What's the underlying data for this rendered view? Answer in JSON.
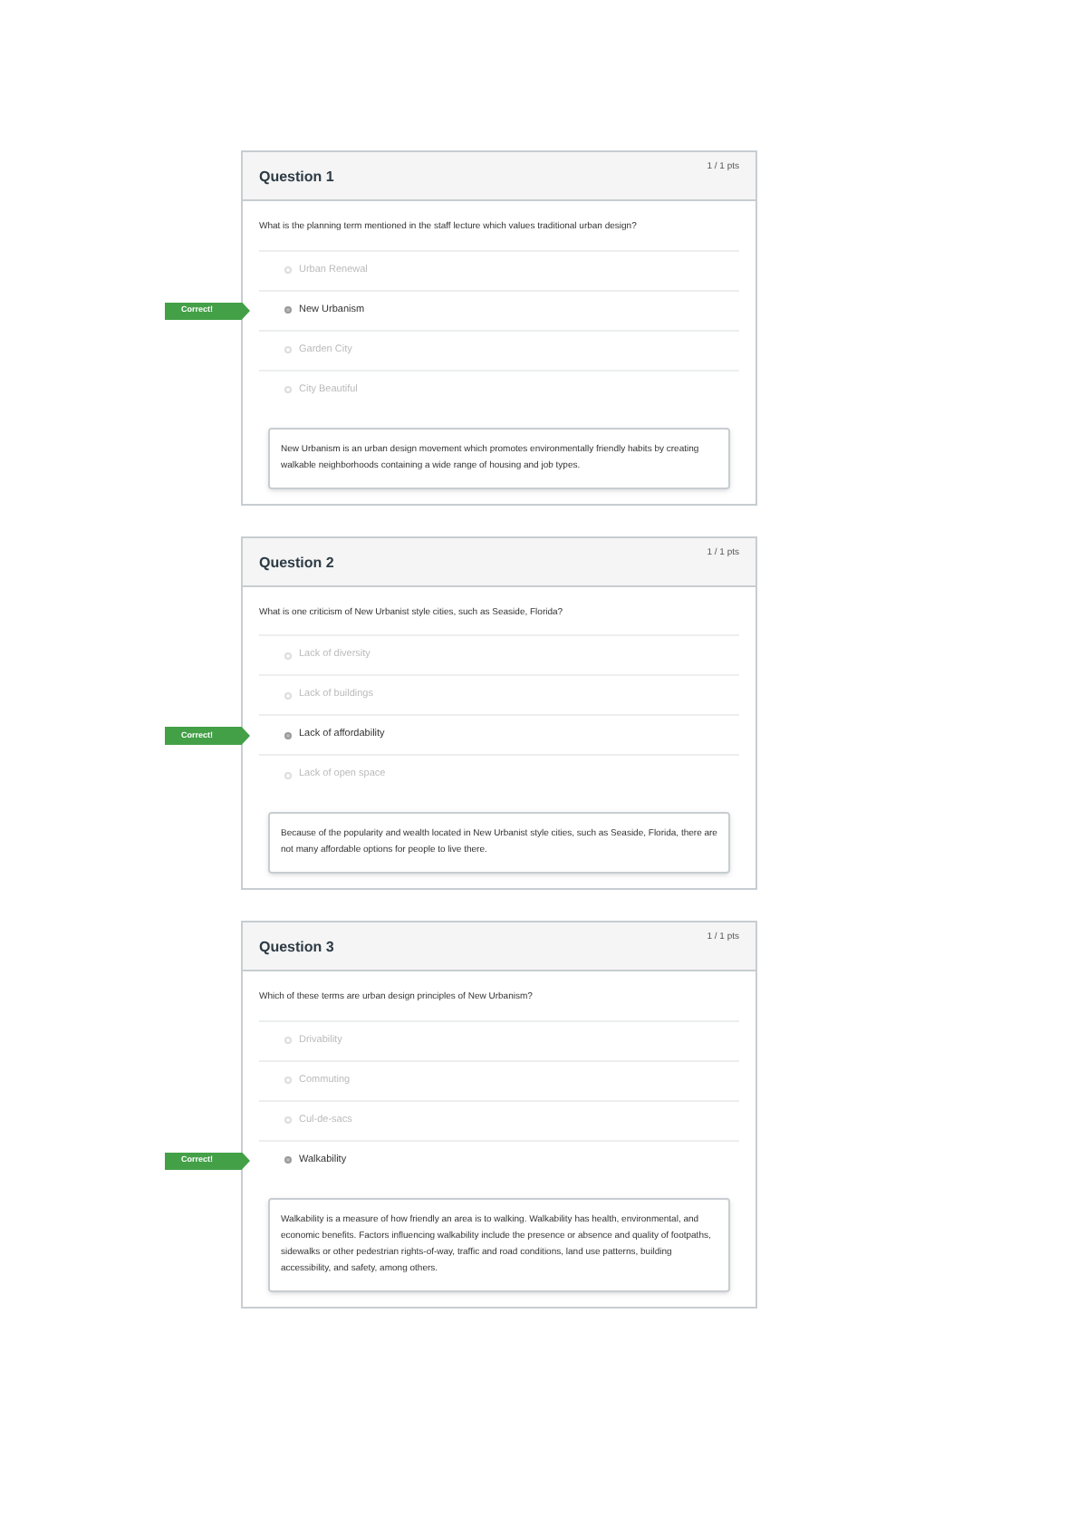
{
  "questions": [
    {
      "title": "Question 1",
      "points": "1 / 1 pts",
      "prompt": "What is the planning term mentioned in the staff lecture which values traditional urban design?",
      "answers": [
        {
          "text": "Urban Renewal",
          "selected": false
        },
        {
          "text": "New Urbanism",
          "selected": true,
          "badge": "Correct!"
        },
        {
          "text": "Garden City",
          "selected": false
        },
        {
          "text": "City Beautiful",
          "selected": false
        }
      ],
      "explanation": "New Urbanism is an urban design movement which promotes environmentally friendly habits by creating walkable neighborhoods containing a wide range of housing and job types."
    },
    {
      "title": "Question 2",
      "points": "1 / 1 pts",
      "prompt": "What is one criticism of New Urbanist style cities, such as Seaside, Florida?",
      "answers": [
        {
          "text": "Lack of diversity",
          "selected": false
        },
        {
          "text": "Lack of buildings",
          "selected": false
        },
        {
          "text": "Lack of affordability",
          "selected": true,
          "badge": "Correct!"
        },
        {
          "text": "Lack of open space",
          "selected": false
        }
      ],
      "explanation": "Because of the popularity and wealth located in New Urbanist style cities, such as Seaside, Florida, there are not many affordable options for people to live there."
    },
    {
      "title": "Question 3",
      "points": "1 / 1 pts",
      "prompt": "Which of these terms are urban design principles of New Urbanism?",
      "answers": [
        {
          "text": "Drivability",
          "selected": false
        },
        {
          "text": "Commuting",
          "selected": false
        },
        {
          "text": "Cul-de-sacs",
          "selected": false
        },
        {
          "text": "Walkability",
          "selected": true,
          "badge": "Correct!"
        }
      ],
      "explanation": "Walkability is a measure of how friendly an area is to walking. Walkability has health, environmental, and economic benefits. Factors influencing walkability include the presence or absence and quality of footpaths, sidewalks or other pedestrian rights-of-way, traffic and road conditions, land use patterns, building accessibility, and safety, among others."
    }
  ]
}
